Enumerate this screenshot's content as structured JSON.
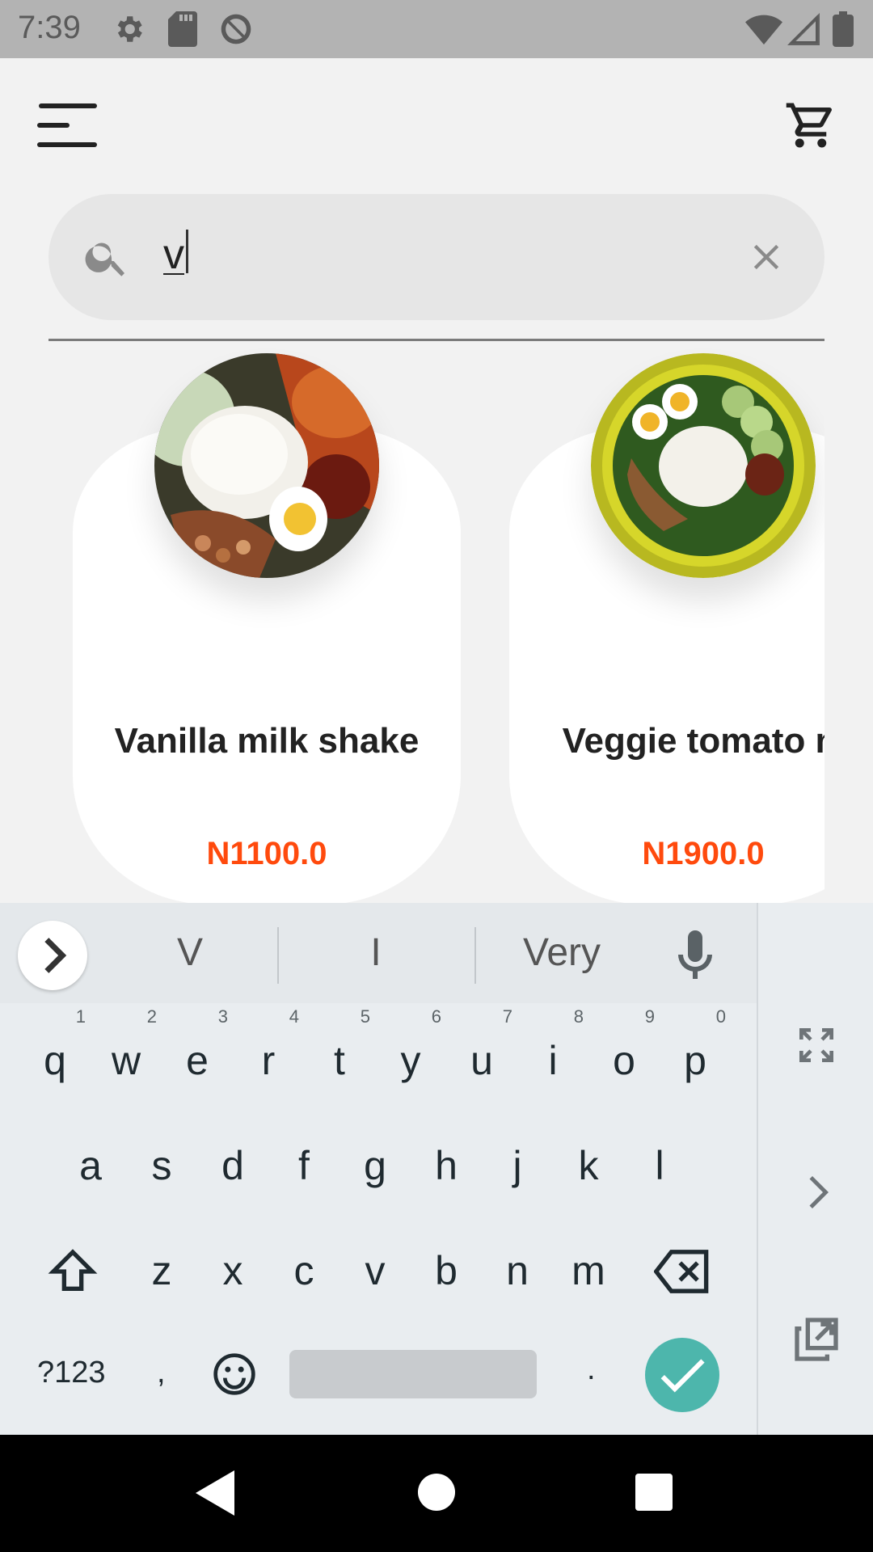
{
  "status_bar": {
    "time": "7:39",
    "icons": [
      "gear-icon",
      "sd-card-icon",
      "no-disturb-icon",
      "wifi-icon",
      "signal-icon",
      "battery-icon"
    ]
  },
  "app_bar": {
    "menu_icon": "menu-icon",
    "cart_icon": "cart-icon"
  },
  "search": {
    "value": "v",
    "icon": "search-icon",
    "clear_icon": "clear-icon"
  },
  "products": [
    {
      "title": "Vanilla milk shake",
      "price": "N1100.0"
    },
    {
      "title": "Veggie tomato mix",
      "price": "N1900.0"
    }
  ],
  "keyboard": {
    "suggestions": [
      "V",
      "I",
      "Very"
    ],
    "row1": [
      "q",
      "w",
      "e",
      "r",
      "t",
      "y",
      "u",
      "i",
      "o",
      "p"
    ],
    "row1_hints": [
      "1",
      "2",
      "3",
      "4",
      "5",
      "6",
      "7",
      "8",
      "9",
      "0"
    ],
    "row2": [
      "a",
      "s",
      "d",
      "f",
      "g",
      "h",
      "j",
      "k",
      "l"
    ],
    "row3": [
      "z",
      "x",
      "c",
      "v",
      "b",
      "n",
      "m"
    ],
    "symbols_key": "?123",
    "comma_key": ",",
    "period_key": "."
  },
  "colors": {
    "price": "#ff4a0d",
    "enter_button": "#4db6ac",
    "status_bar": "#b3b3b3"
  }
}
